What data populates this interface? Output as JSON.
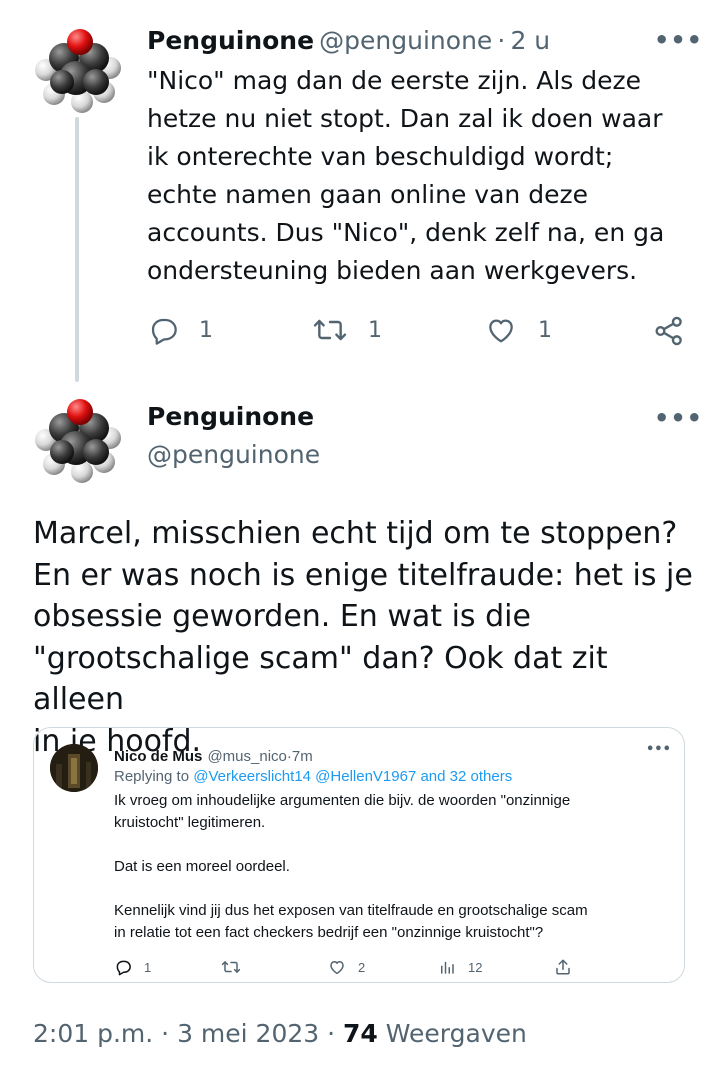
{
  "reply_tweet": {
    "author_name": "Penguinone",
    "author_handle": "@penguinone",
    "separator": "·",
    "time": "2 u",
    "text_lines": [
      "\"Nico\" mag dan de eerste zijn. Als deze",
      "hetze nu niet stopt. Dan zal ik doen waar",
      "ik onterechte van beschuldigd wordt;",
      "echte namen gaan online van deze",
      "accounts. Dus \"Nico\", denk zelf na, en ga",
      "ondersteuning bieden aan werkgevers."
    ],
    "reply_count": "1",
    "retweet_count": "1",
    "like_count": "1"
  },
  "main_tweet": {
    "author_name": "Penguinone",
    "author_handle": "@penguinone",
    "text_lines": [
      "Marcel, misschien echt tijd om te stoppen?",
      "En er was noch is enige titelfraude: het is je",
      "obsessie geworden. En wat is die",
      "\"grootschalige scam\" dan? Ook dat zit alleen",
      "in je hoofd."
    ],
    "quote": {
      "author_name": "Nico de Mus",
      "author_handle": "@mus_nico",
      "separator": "·",
      "time": "7m",
      "replying_prefix": "Replying to",
      "replying_to": "@Verkeerslicht14 @HellenV1967 and 32 others",
      "text_lines": [
        "Ik vroeg om inhoudelijke argumenten die bijv. de woorden \"onzinnige",
        "kruistocht\" legitimeren.",
        "",
        "Dat is een moreel oordeel.",
        "",
        "Kennelijk vind jij dus het exposen van titelfraude en  grootschalige scam",
        "in relatie tot een fact checkers bedrijf een \"onzinnige kruistocht\"?"
      ],
      "reply_count": "1",
      "like_count": "2",
      "views_count": "12"
    },
    "footer": {
      "time": "2:01 p.m.",
      "sep1": "·",
      "date": "3 mei 2023",
      "sep2": "·",
      "views": "74",
      "views_label": "Weergaven"
    }
  },
  "colors": {
    "text": "#0f1419",
    "secondary": "#536471",
    "link": "#1d9bf0",
    "border": "#cfd9de"
  },
  "icons": [
    "molecule-avatar",
    "more-icon",
    "reply-icon",
    "retweet-icon",
    "like-icon",
    "share-icon",
    "views-icon"
  ]
}
